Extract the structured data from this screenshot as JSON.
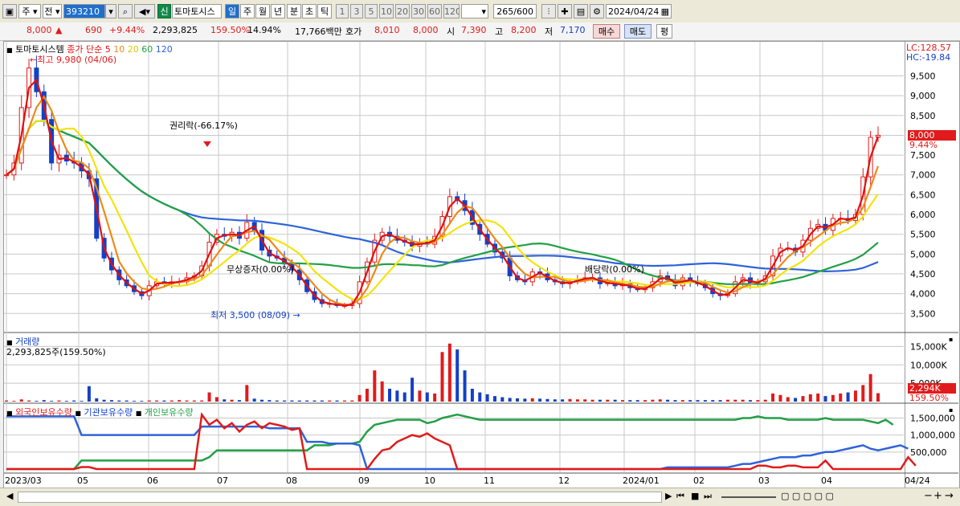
{
  "toolbar": {
    "market": "주",
    "prev": "전",
    "code": "393210",
    "sin": "신",
    "name": "토마토시스",
    "periods": [
      "일",
      "주",
      "월",
      "년",
      "분",
      "초",
      "틱"
    ],
    "nums": [
      "1",
      "3",
      "5",
      "10",
      "20",
      "30",
      "60",
      "120"
    ],
    "count": "265",
    "count_total": "/600",
    "date": "2024/04/24"
  },
  "info": {
    "price": "8,000",
    "arrow": "▲",
    "change": "690",
    "pct": "+9.44%",
    "volume": "2,293,825",
    "vol_ratio": "159.50%",
    "turnover": "14.94%",
    "amount": "17,766백만",
    "hoga_label": "호가",
    "hoga1": "8,010",
    "hoga2": "8,000",
    "open_label": "시",
    "open": "7,390",
    "high_label": "고",
    "high": "8,200",
    "low_label": "저",
    "low": "7,170",
    "buy": "매수",
    "sell": "매도",
    "eval": "평"
  },
  "legend": {
    "name": "토마토시스템",
    "close_label": "종가 단순",
    "ma": [
      "5",
      "10",
      "20",
      "60",
      "120"
    ]
  },
  "chart_data": [
    {
      "type": "candlestick",
      "title": "토마토시스템",
      "y_ticks": [
        3500,
        4000,
        4500,
        5000,
        5500,
        6000,
        6500,
        7000,
        7500,
        8000,
        8500,
        9000,
        9500
      ],
      "ylim": [
        3100,
        10200
      ],
      "x_labels": [
        "2023/03",
        "05",
        "06",
        "07",
        "08",
        "09",
        "10",
        "11",
        "12",
        "2024/01",
        "02",
        "03",
        "04",
        "04/24"
      ],
      "annotations": {
        "high": "최고 9,980 (04/06)",
        "low": "최저 3,500 (08/09)",
        "rights": "권리락(-66.17%)",
        "split": "무상증자(0.00%)",
        "dividend": "배당락(0.00%)"
      },
      "current": "8,000",
      "current_pct": "9.44%",
      "lc": "LC:128.57",
      "hc": "HC:-19.84",
      "close": [
        7000,
        7300,
        8700,
        9700,
        9100,
        8400,
        7300,
        7500,
        7350,
        7300,
        7100,
        6900,
        5400,
        4900,
        4600,
        4350,
        4200,
        4050,
        3950,
        4200,
        4300,
        4250,
        4300,
        4300,
        4400,
        4450,
        4700,
        5300,
        5500,
        5450,
        5550,
        5400,
        5800,
        5600,
        5100,
        4950,
        4900,
        4750,
        4600,
        4350,
        4050,
        3850,
        3750,
        3750,
        3700,
        3700,
        3750,
        4300,
        4800,
        5350,
        5550,
        5450,
        5350,
        5300,
        5200,
        5300,
        5250,
        5450,
        5950,
        6450,
        6350,
        6100,
        5750,
        5500,
        5250,
        5050,
        4900,
        4450,
        4350,
        4300,
        4550,
        4500,
        4350,
        4300,
        4250,
        4300,
        4350,
        4400,
        4400,
        4250,
        4300,
        4200,
        4250,
        4150,
        4100,
        4150,
        4300,
        4450,
        4350,
        4200,
        4400,
        4300,
        4250,
        4150,
        4000,
        3950,
        4000,
        4300,
        4400,
        4250,
        4300,
        4450,
        4950,
        5150,
        5150,
        5050,
        5350,
        5650,
        5750,
        5600,
        5900,
        5900,
        5850,
        6000,
        6950,
        7950,
        8000
      ]
    },
    {
      "type": "bar",
      "title": "거래량",
      "value_label": "2,293,825주(159.50%)",
      "y_ticks": [
        "5,000K",
        "10,000K",
        "15,000K"
      ],
      "current": "2,294K",
      "current_pct": "159.50%",
      "values": [
        300,
        200,
        600,
        300,
        200,
        400,
        200,
        300,
        200,
        300,
        200,
        4200,
        900,
        500,
        400,
        300,
        300,
        200,
        200,
        300,
        300,
        300,
        300,
        400,
        300,
        300,
        300,
        2500,
        1200,
        600,
        500,
        400,
        4500,
        800,
        500,
        400,
        300,
        300,
        300,
        300,
        300,
        300,
        300,
        300,
        300,
        300,
        300,
        1800,
        3500,
        8500,
        5500,
        3500,
        3000,
        2500,
        6500,
        3000,
        2500,
        2200,
        13500,
        15800,
        14200,
        8500,
        3500,
        2500,
        2000,
        1500,
        1200,
        1000,
        900,
        800,
        900,
        800,
        700,
        600,
        600,
        700,
        600,
        600,
        500,
        500,
        500,
        500,
        400,
        400,
        400,
        400,
        500,
        600,
        500,
        400,
        400,
        400,
        400,
        400,
        400,
        400,
        500,
        500,
        500,
        400,
        400,
        500,
        2200,
        1800,
        1200,
        1000,
        1500,
        2000,
        2200,
        1500,
        1800,
        2200,
        2500,
        3000,
        4500,
        7500,
        2294
      ]
    },
    {
      "type": "line",
      "title": "보유수량",
      "series_names": [
        "외국인보유수량",
        "기관보유수량",
        "개인보유수량"
      ],
      "y_ticks": [
        "500,000",
        "1,000,000",
        "1,500,000"
      ],
      "foreign": [
        0,
        0,
        0,
        0,
        0,
        0,
        0,
        0,
        0,
        0,
        60000,
        60000,
        0,
        0,
        0,
        0,
        0,
        0,
        0,
        0,
        0,
        0,
        0,
        0,
        0,
        0,
        1600000,
        1300000,
        1450000,
        1200000,
        1350000,
        1100000,
        1300000,
        1400000,
        1200000,
        1350000,
        1300000,
        1250000,
        1150000,
        1200000,
        0,
        0,
        0,
        0,
        0,
        0,
        0,
        0,
        0,
        300000,
        550000,
        600000,
        800000,
        900000,
        1000000,
        950000,
        1050000,
        900000,
        800000,
        700000,
        0,
        0,
        0,
        0,
        0,
        0,
        0,
        0,
        0,
        0,
        0,
        0,
        0,
        0,
        0,
        0,
        0,
        0,
        0,
        0,
        0,
        0,
        0,
        0,
        0,
        0,
        0,
        0,
        0,
        0,
        0,
        0,
        0,
        0,
        0,
        0,
        0,
        0,
        0,
        0,
        100000,
        100000,
        50000,
        50000,
        100000,
        100000,
        50000,
        50000,
        50000,
        250000,
        0,
        0,
        0,
        0,
        0,
        0,
        0,
        0,
        0,
        0,
        350000,
        100000
      ],
      "institution": [
        1550000,
        1550000,
        1550000,
        1550000,
        1550000,
        1550000,
        1550000,
        1550000,
        1550000,
        1550000,
        1000000,
        1000000,
        1000000,
        1000000,
        1000000,
        1000000,
        1000000,
        1000000,
        1000000,
        1000000,
        1000000,
        1000000,
        1000000,
        1000000,
        1000000,
        1000000,
        1250000,
        1250000,
        1250000,
        1250000,
        1250000,
        1250000,
        1250000,
        1250000,
        1250000,
        1200000,
        1200000,
        1200000,
        1200000,
        1200000,
        800000,
        800000,
        800000,
        750000,
        750000,
        750000,
        750000,
        700000,
        0,
        0,
        0,
        0,
        0,
        0,
        0,
        0,
        0,
        0,
        0,
        0,
        0,
        0,
        0,
        0,
        0,
        0,
        0,
        0,
        0,
        0,
        0,
        0,
        0,
        0,
        0,
        0,
        0,
        0,
        0,
        0,
        0,
        0,
        0,
        0,
        0,
        0,
        0,
        0,
        50000,
        50000,
        50000,
        50000,
        50000,
        50000,
        50000,
        50000,
        50000,
        100000,
        150000,
        150000,
        200000,
        250000,
        300000,
        350000,
        350000,
        350000,
        400000,
        400000,
        450000,
        500000,
        500000,
        550000,
        600000,
        650000,
        700000,
        600000,
        550000,
        600000,
        650000,
        700000,
        600000
      ],
      "individual": [
        0,
        0,
        0,
        0,
        0,
        0,
        0,
        0,
        0,
        0,
        250000,
        250000,
        250000,
        250000,
        250000,
        250000,
        250000,
        250000,
        250000,
        250000,
        250000,
        250000,
        250000,
        250000,
        250000,
        250000,
        250000,
        350000,
        550000,
        550000,
        550000,
        550000,
        550000,
        550000,
        550000,
        550000,
        550000,
        550000,
        550000,
        550000,
        550000,
        700000,
        700000,
        700000,
        750000,
        750000,
        750000,
        800000,
        1100000,
        1300000,
        1350000,
        1400000,
        1450000,
        1450000,
        1450000,
        1450000,
        1350000,
        1400000,
        1500000,
        1550000,
        1600000,
        1550000,
        1500000,
        1450000,
        1450000,
        1450000,
        1450000,
        1450000,
        1450000,
        1450000,
        1450000,
        1450000,
        1450000,
        1450000,
        1450000,
        1450000,
        1450000,
        1450000,
        1450000,
        1450000,
        1450000,
        1450000,
        1450000,
        1450000,
        1450000,
        1450000,
        1450000,
        1450000,
        1450000,
        1450000,
        1450000,
        1450000,
        1450000,
        1450000,
        1450000,
        1450000,
        1450000,
        1450000,
        1500000,
        1500000,
        1550000,
        1500000,
        1500000,
        1500000,
        1450000,
        1450000,
        1450000,
        1450000,
        1450000,
        1500000,
        1450000,
        1450000,
        1450000,
        1450000,
        1450000,
        1400000,
        1350000,
        1450000,
        1300000
      ]
    }
  ],
  "colors": {
    "up": "#e11b1b",
    "down": "#1340c8",
    "ma5": "#e01010",
    "ma10": "#ee8a18",
    "ma20": "#f2e40c",
    "ma60": "#22a046",
    "ma120": "#2f63d8",
    "grid": "#c8c8c8"
  }
}
